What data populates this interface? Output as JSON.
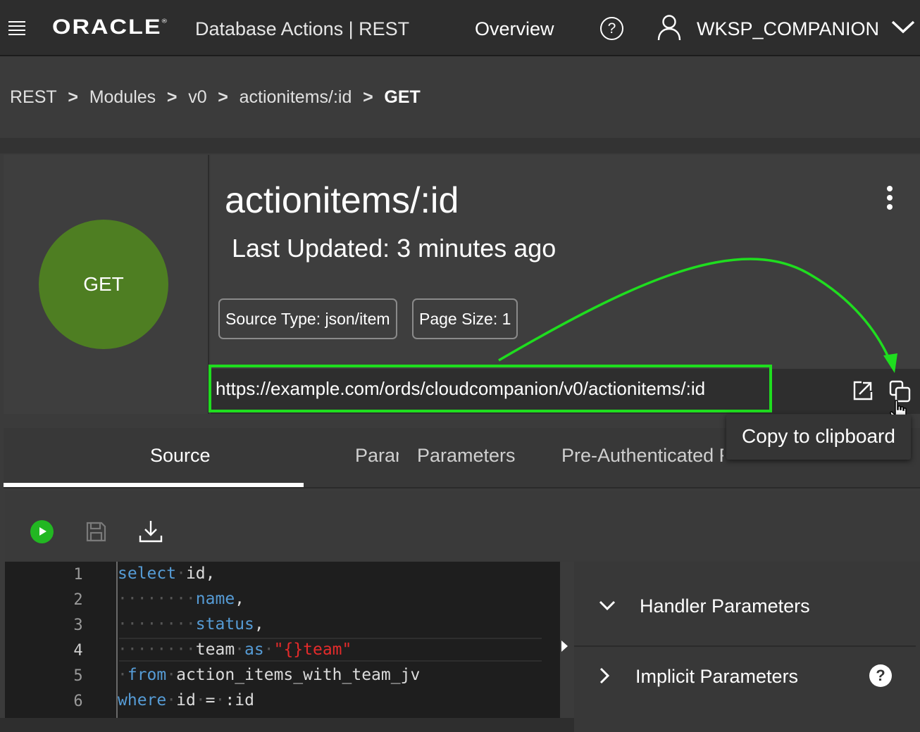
{
  "topbar": {
    "logo": "ORACLE",
    "app_title": "Database Actions |  REST",
    "overview_label": "Overview",
    "help_label": "?",
    "username": "WKSP_COMPANION",
    "icons": [
      "hamburger-icon",
      "help-icon",
      "user-icon",
      "chevron-down-icon"
    ]
  },
  "breadcrumb": {
    "items": [
      "REST",
      "Modules",
      "v0",
      "actionitems/:id",
      "GET"
    ],
    "separator": ">"
  },
  "handler": {
    "method": "GET",
    "title": "actionitems/:id",
    "last_updated": "Last Updated: 3 minutes ago",
    "source_type": "Source Type: json/item",
    "page_size": "Page Size: 1",
    "url": "https://example.com/ords/cloudcompanion/v0/actionitems/:id",
    "method_color": "#4e7e22",
    "highlight_color": "#1fdd1f"
  },
  "tooltip": {
    "text": "Copy to clipboard"
  },
  "tabs": {
    "source": "Source",
    "parameters_clipped": "Parameters",
    "parameters": "Parameters",
    "preauth": "Pre-Authenticated Requests"
  },
  "editor": {
    "line_numbers": [
      "1",
      "2",
      "3",
      "4",
      "5",
      "6"
    ],
    "current_line": "4",
    "lines": [
      "select id,",
      "name,",
      "status,",
      "team as \"{}team\"",
      "from action_items_with_team_jv",
      "where id = :id"
    ]
  },
  "right_panel": {
    "handler_parameters": "Handler Parameters",
    "implicit_parameters": "Implicit Parameters",
    "help_label": "?"
  }
}
